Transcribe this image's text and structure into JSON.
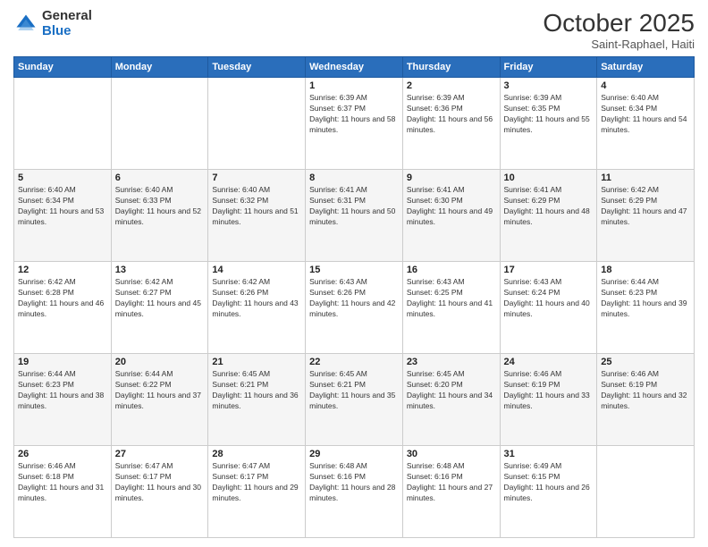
{
  "header": {
    "logo_general": "General",
    "logo_blue": "Blue",
    "month": "October 2025",
    "location": "Saint-Raphael, Haiti"
  },
  "days_of_week": [
    "Sunday",
    "Monday",
    "Tuesday",
    "Wednesday",
    "Thursday",
    "Friday",
    "Saturday"
  ],
  "weeks": [
    [
      {
        "day": "",
        "info": ""
      },
      {
        "day": "",
        "info": ""
      },
      {
        "day": "",
        "info": ""
      },
      {
        "day": "1",
        "info": "Sunrise: 6:39 AM\nSunset: 6:37 PM\nDaylight: 11 hours and 58 minutes."
      },
      {
        "day": "2",
        "info": "Sunrise: 6:39 AM\nSunset: 6:36 PM\nDaylight: 11 hours and 56 minutes."
      },
      {
        "day": "3",
        "info": "Sunrise: 6:39 AM\nSunset: 6:35 PM\nDaylight: 11 hours and 55 minutes."
      },
      {
        "day": "4",
        "info": "Sunrise: 6:40 AM\nSunset: 6:34 PM\nDaylight: 11 hours and 54 minutes."
      }
    ],
    [
      {
        "day": "5",
        "info": "Sunrise: 6:40 AM\nSunset: 6:34 PM\nDaylight: 11 hours and 53 minutes."
      },
      {
        "day": "6",
        "info": "Sunrise: 6:40 AM\nSunset: 6:33 PM\nDaylight: 11 hours and 52 minutes."
      },
      {
        "day": "7",
        "info": "Sunrise: 6:40 AM\nSunset: 6:32 PM\nDaylight: 11 hours and 51 minutes."
      },
      {
        "day": "8",
        "info": "Sunrise: 6:41 AM\nSunset: 6:31 PM\nDaylight: 11 hours and 50 minutes."
      },
      {
        "day": "9",
        "info": "Sunrise: 6:41 AM\nSunset: 6:30 PM\nDaylight: 11 hours and 49 minutes."
      },
      {
        "day": "10",
        "info": "Sunrise: 6:41 AM\nSunset: 6:29 PM\nDaylight: 11 hours and 48 minutes."
      },
      {
        "day": "11",
        "info": "Sunrise: 6:42 AM\nSunset: 6:29 PM\nDaylight: 11 hours and 47 minutes."
      }
    ],
    [
      {
        "day": "12",
        "info": "Sunrise: 6:42 AM\nSunset: 6:28 PM\nDaylight: 11 hours and 46 minutes."
      },
      {
        "day": "13",
        "info": "Sunrise: 6:42 AM\nSunset: 6:27 PM\nDaylight: 11 hours and 45 minutes."
      },
      {
        "day": "14",
        "info": "Sunrise: 6:42 AM\nSunset: 6:26 PM\nDaylight: 11 hours and 43 minutes."
      },
      {
        "day": "15",
        "info": "Sunrise: 6:43 AM\nSunset: 6:26 PM\nDaylight: 11 hours and 42 minutes."
      },
      {
        "day": "16",
        "info": "Sunrise: 6:43 AM\nSunset: 6:25 PM\nDaylight: 11 hours and 41 minutes."
      },
      {
        "day": "17",
        "info": "Sunrise: 6:43 AM\nSunset: 6:24 PM\nDaylight: 11 hours and 40 minutes."
      },
      {
        "day": "18",
        "info": "Sunrise: 6:44 AM\nSunset: 6:23 PM\nDaylight: 11 hours and 39 minutes."
      }
    ],
    [
      {
        "day": "19",
        "info": "Sunrise: 6:44 AM\nSunset: 6:23 PM\nDaylight: 11 hours and 38 minutes."
      },
      {
        "day": "20",
        "info": "Sunrise: 6:44 AM\nSunset: 6:22 PM\nDaylight: 11 hours and 37 minutes."
      },
      {
        "day": "21",
        "info": "Sunrise: 6:45 AM\nSunset: 6:21 PM\nDaylight: 11 hours and 36 minutes."
      },
      {
        "day": "22",
        "info": "Sunrise: 6:45 AM\nSunset: 6:21 PM\nDaylight: 11 hours and 35 minutes."
      },
      {
        "day": "23",
        "info": "Sunrise: 6:45 AM\nSunset: 6:20 PM\nDaylight: 11 hours and 34 minutes."
      },
      {
        "day": "24",
        "info": "Sunrise: 6:46 AM\nSunset: 6:19 PM\nDaylight: 11 hours and 33 minutes."
      },
      {
        "day": "25",
        "info": "Sunrise: 6:46 AM\nSunset: 6:19 PM\nDaylight: 11 hours and 32 minutes."
      }
    ],
    [
      {
        "day": "26",
        "info": "Sunrise: 6:46 AM\nSunset: 6:18 PM\nDaylight: 11 hours and 31 minutes."
      },
      {
        "day": "27",
        "info": "Sunrise: 6:47 AM\nSunset: 6:17 PM\nDaylight: 11 hours and 30 minutes."
      },
      {
        "day": "28",
        "info": "Sunrise: 6:47 AM\nSunset: 6:17 PM\nDaylight: 11 hours and 29 minutes."
      },
      {
        "day": "29",
        "info": "Sunrise: 6:48 AM\nSunset: 6:16 PM\nDaylight: 11 hours and 28 minutes."
      },
      {
        "day": "30",
        "info": "Sunrise: 6:48 AM\nSunset: 6:16 PM\nDaylight: 11 hours and 27 minutes."
      },
      {
        "day": "31",
        "info": "Sunrise: 6:49 AM\nSunset: 6:15 PM\nDaylight: 11 hours and 26 minutes."
      },
      {
        "day": "",
        "info": ""
      }
    ]
  ]
}
